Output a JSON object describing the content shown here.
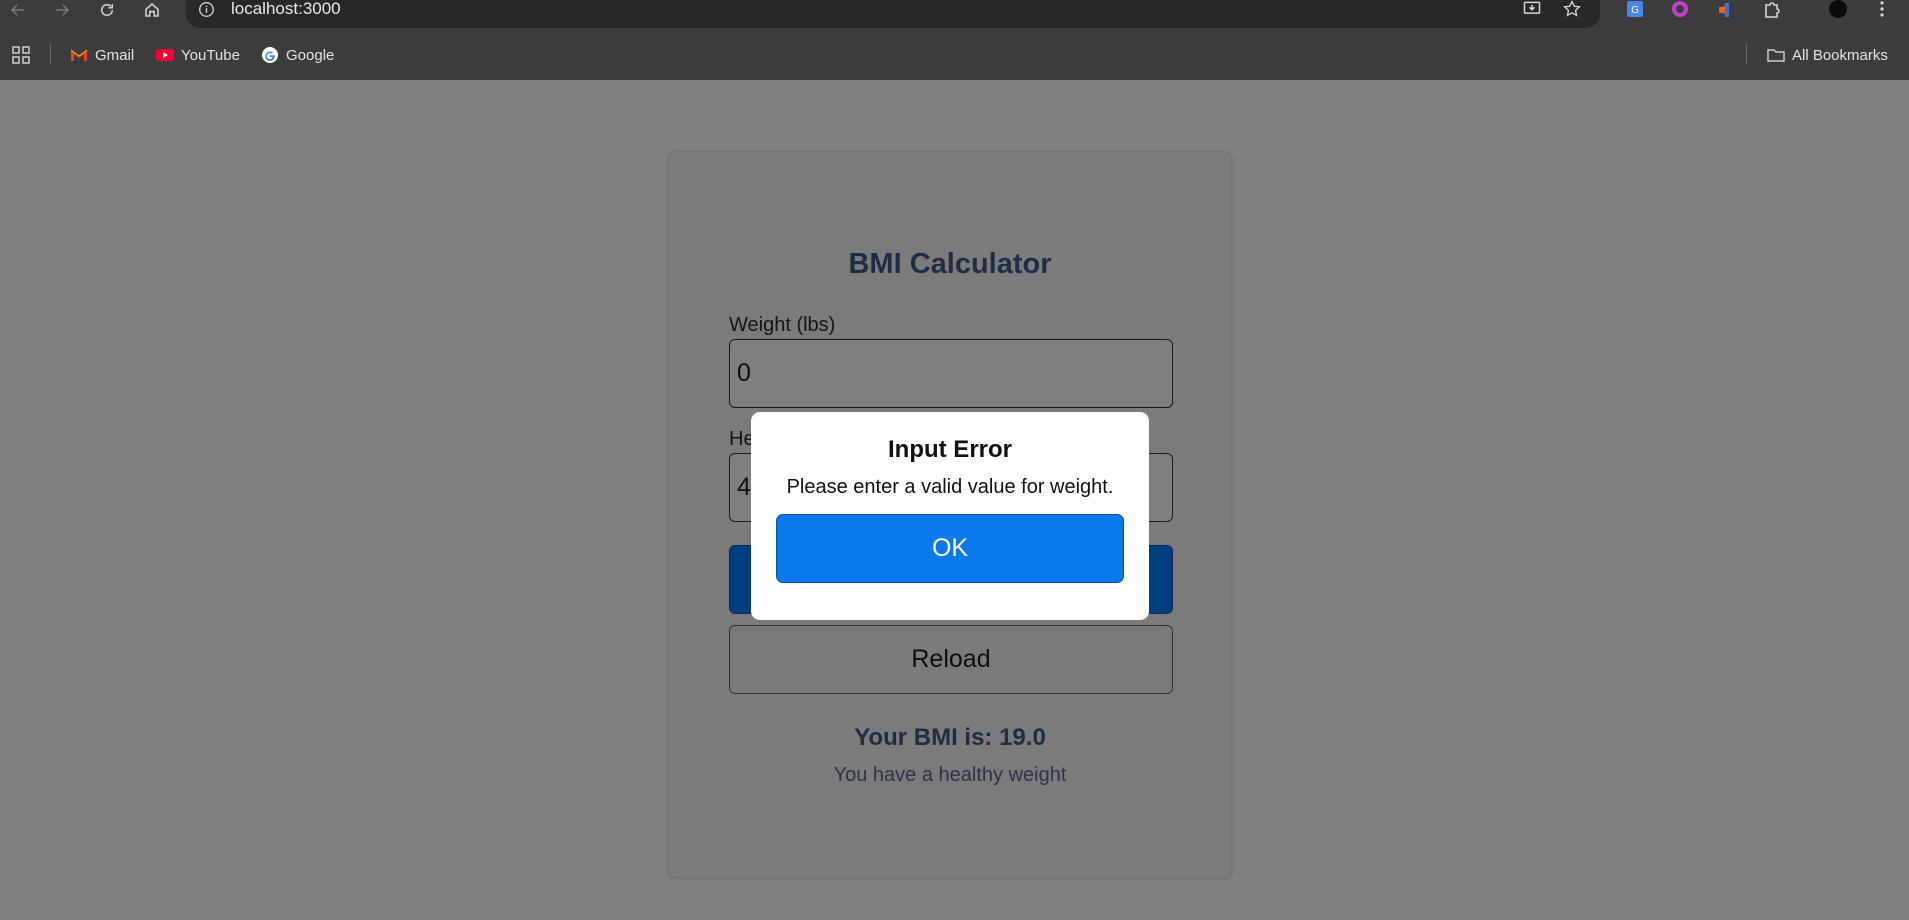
{
  "browser": {
    "url": "localhost:3000",
    "bookmarks": [
      {
        "label": "Gmail",
        "icon": "gmail-icon"
      },
      {
        "label": "YouTube",
        "icon": "youtube-icon"
      },
      {
        "label": "Google",
        "icon": "google-icon"
      }
    ],
    "all_bookmarks_label": "All Bookmarks"
  },
  "calculator": {
    "title": "BMI Calculator",
    "weight_label": "Weight (lbs)",
    "weight_value": "0",
    "height_label_visible": "He",
    "height_value_visible": "4",
    "reload_label": "Reload",
    "result_text": "Your BMI is: 19.0",
    "status_text": "You have a healthy weight"
  },
  "dialog": {
    "title": "Input Error",
    "message": "Please enter a valid value for weight.",
    "ok_label": "OK"
  },
  "colors": {
    "overlay": "#808080",
    "calculate_button": "#013e80",
    "ok_button": "#0a79ec",
    "heading_text": "#1f2d44"
  }
}
